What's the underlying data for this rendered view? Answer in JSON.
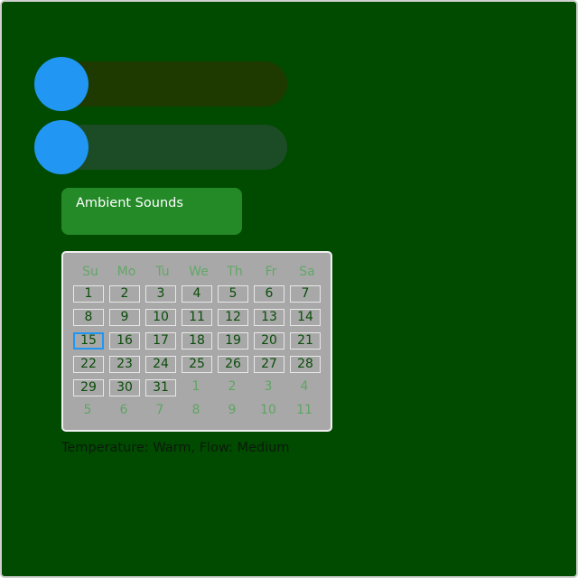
{
  "sliders": [
    {
      "name": "slider-1",
      "value_fraction": 0.0,
      "track_color": "#1e3a00",
      "thumb_color": "#2196f3"
    },
    {
      "name": "slider-2",
      "value_fraction": 0.0,
      "track_color": "#1c4c26",
      "thumb_color": "#2196f3"
    }
  ],
  "ambient_button": {
    "label": "Ambient Sounds",
    "color": "#238a27"
  },
  "calendar": {
    "weekdays": [
      "Su",
      "Mo",
      "Tu",
      "We",
      "Th",
      "Fr",
      "Sa"
    ],
    "selected_day": "15",
    "weeks": [
      [
        {
          "d": "1",
          "m": "cur"
        },
        {
          "d": "2",
          "m": "cur"
        },
        {
          "d": "3",
          "m": "cur"
        },
        {
          "d": "4",
          "m": "cur"
        },
        {
          "d": "5",
          "m": "cur"
        },
        {
          "d": "6",
          "m": "cur"
        },
        {
          "d": "7",
          "m": "cur"
        }
      ],
      [
        {
          "d": "8",
          "m": "cur"
        },
        {
          "d": "9",
          "m": "cur"
        },
        {
          "d": "10",
          "m": "cur"
        },
        {
          "d": "11",
          "m": "cur"
        },
        {
          "d": "12",
          "m": "cur"
        },
        {
          "d": "13",
          "m": "cur"
        },
        {
          "d": "14",
          "m": "cur"
        }
      ],
      [
        {
          "d": "15",
          "m": "cur"
        },
        {
          "d": "16",
          "m": "cur"
        },
        {
          "d": "17",
          "m": "cur"
        },
        {
          "d": "18",
          "m": "cur"
        },
        {
          "d": "19",
          "m": "cur"
        },
        {
          "d": "20",
          "m": "cur"
        },
        {
          "d": "21",
          "m": "cur"
        }
      ],
      [
        {
          "d": "22",
          "m": "cur"
        },
        {
          "d": "23",
          "m": "cur"
        },
        {
          "d": "24",
          "m": "cur"
        },
        {
          "d": "25",
          "m": "cur"
        },
        {
          "d": "26",
          "m": "cur"
        },
        {
          "d": "27",
          "m": "cur"
        },
        {
          "d": "28",
          "m": "cur"
        }
      ],
      [
        {
          "d": "29",
          "m": "cur"
        },
        {
          "d": "30",
          "m": "cur"
        },
        {
          "d": "31",
          "m": "cur"
        },
        {
          "d": "1",
          "m": "next"
        },
        {
          "d": "2",
          "m": "next"
        },
        {
          "d": "3",
          "m": "next"
        },
        {
          "d": "4",
          "m": "next"
        }
      ],
      [
        {
          "d": "5",
          "m": "next"
        },
        {
          "d": "6",
          "m": "next"
        },
        {
          "d": "7",
          "m": "next"
        },
        {
          "d": "8",
          "m": "next"
        },
        {
          "d": "9",
          "m": "next"
        },
        {
          "d": "10",
          "m": "next"
        },
        {
          "d": "11",
          "m": "next"
        }
      ]
    ]
  },
  "status": {
    "text": "Temperature: Warm, Flow: Medium"
  },
  "colors": {
    "background": "#004b00",
    "accent": "#2196f3"
  }
}
